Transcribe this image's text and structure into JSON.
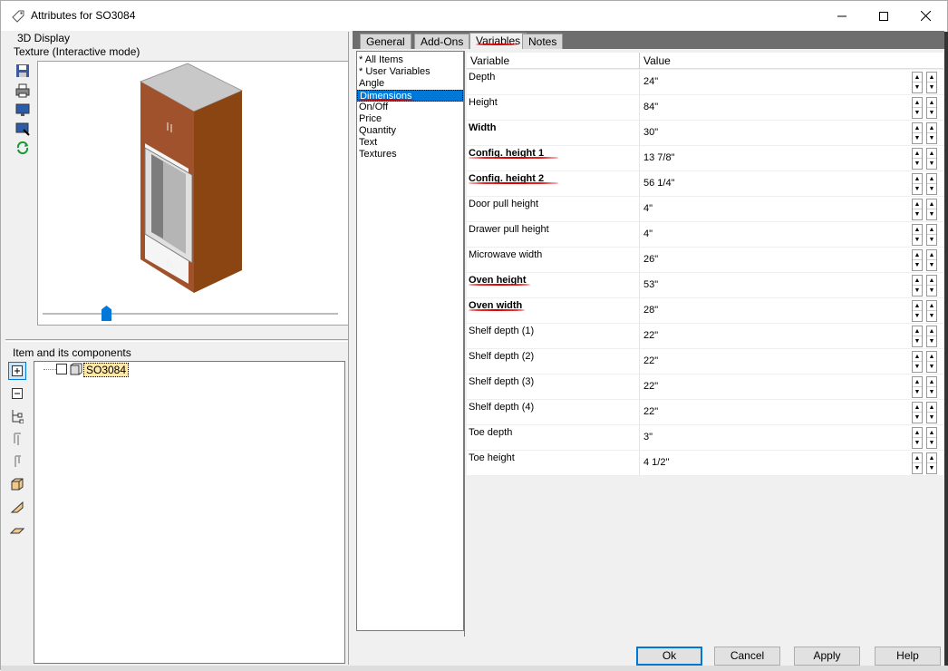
{
  "window": {
    "title": "Attributes for SO3084"
  },
  "left": {
    "display_label": "3D Display",
    "mode_label": "Texture (Interactive mode)",
    "tree_label": "Item and its components",
    "tree_item": "SO3084"
  },
  "tabs": [
    {
      "label": "General"
    },
    {
      "label": "Add-Ons"
    },
    {
      "label": "Variables"
    },
    {
      "label": "Notes"
    }
  ],
  "categories": [
    {
      "label": "* All Items"
    },
    {
      "label": "* User Variables"
    },
    {
      "label": "Angle"
    },
    {
      "label": "Dimensions"
    },
    {
      "label": "On/Off"
    },
    {
      "label": "Price"
    },
    {
      "label": "Quantity"
    },
    {
      "label": "Text"
    },
    {
      "label": "Textures"
    }
  ],
  "grid": {
    "col_variable": "Variable",
    "col_value": "Value",
    "rows": [
      {
        "variable": "Depth",
        "value": "24\""
      },
      {
        "variable": "Height",
        "value": "84\""
      },
      {
        "variable": "Width",
        "value": "30\""
      },
      {
        "variable": "Config. height 1",
        "value": "13 7/8\""
      },
      {
        "variable": "Config. height 2",
        "value": "56 1/4\""
      },
      {
        "variable": "Door pull height",
        "value": "4\""
      },
      {
        "variable": "Drawer pull height",
        "value": "4\""
      },
      {
        "variable": "Microwave width",
        "value": "26\""
      },
      {
        "variable": "Oven height",
        "value": "53\""
      },
      {
        "variable": "Oven width",
        "value": "28\""
      },
      {
        "variable": "Shelf depth (1)",
        "value": "22\""
      },
      {
        "variable": "Shelf depth (2)",
        "value": "22\""
      },
      {
        "variable": "Shelf depth (3)",
        "value": "22\""
      },
      {
        "variable": "Shelf depth (4)",
        "value": "22\""
      },
      {
        "variable": "Toe depth",
        "value": "3\""
      },
      {
        "variable": "Toe height",
        "value": "4 1/2\""
      }
    ]
  },
  "buttons": {
    "ok": "Ok",
    "cancel": "Cancel",
    "apply": "Apply",
    "help": "Help"
  },
  "colors": {
    "selection": "#0078d7",
    "annotation": "#dd0000",
    "cabinet": "#a0522d"
  }
}
